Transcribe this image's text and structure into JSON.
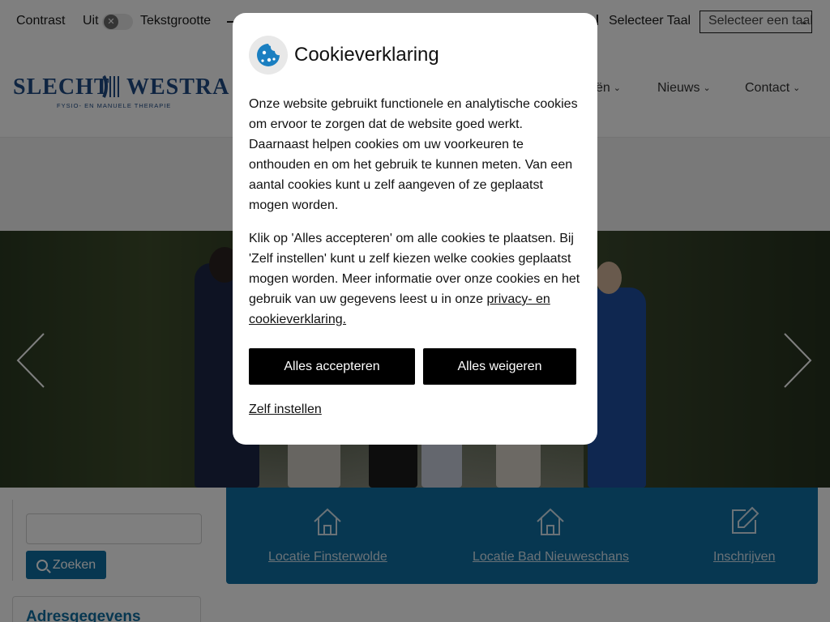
{
  "topbar": {
    "contrast_label": "Contrast",
    "contrast_state": "Uit",
    "text_size_label": "Tekstgrootte",
    "language_label": "Selecteer Taal",
    "language_select_value": "Selecteer een taal"
  },
  "header": {
    "logo_left": "SLECHT",
    "logo_right": "WESTRA",
    "logo_tagline": "FYSIO- EN MANUELE THERAPIE",
    "nav": [
      {
        "label": "ën"
      },
      {
        "label": "Nieuws"
      },
      {
        "label": "Contact"
      }
    ]
  },
  "search": {
    "input_value": "",
    "button_label": "Zoeken"
  },
  "address_card": {
    "title": "Adresgegevens"
  },
  "quicklinks": [
    {
      "label": "Locatie Finsterwolde",
      "icon": "home-icon"
    },
    {
      "label": "Locatie Bad Nieuweschans",
      "icon": "home-icon"
    },
    {
      "label": "Inschrijven",
      "icon": "edit-icon"
    }
  ],
  "cookie_modal": {
    "title": "Cookieverklaring",
    "paragraph_1": "Onze website gebruikt functionele en analytische cookies om ervoor te zorgen dat de website goed werkt. Daarnaast helpen cookies om uw voorkeuren te onthouden en om het gebruik te kunnen meten. Van een aantal cookies kunt u zelf aangeven of ze geplaatst mogen worden.",
    "paragraph_2": "Klik op 'Alles accepteren' om alle cookies te plaatsen. Bij 'Zelf instellen' kunt u zelf kiezen welke cookies geplaatst mogen worden. Meer informatie over onze cookies en het gebruik van uw gegevens leest u in onze ",
    "privacy_link": "privacy- en cookieverklaring.",
    "accept_all": "Alles accepteren",
    "reject_all": "Alles weigeren",
    "customize": "Zelf instellen"
  },
  "colors": {
    "brand_blue": "#0f6fa3",
    "logo_blue": "#1f4a85",
    "button_black": "#000000"
  }
}
